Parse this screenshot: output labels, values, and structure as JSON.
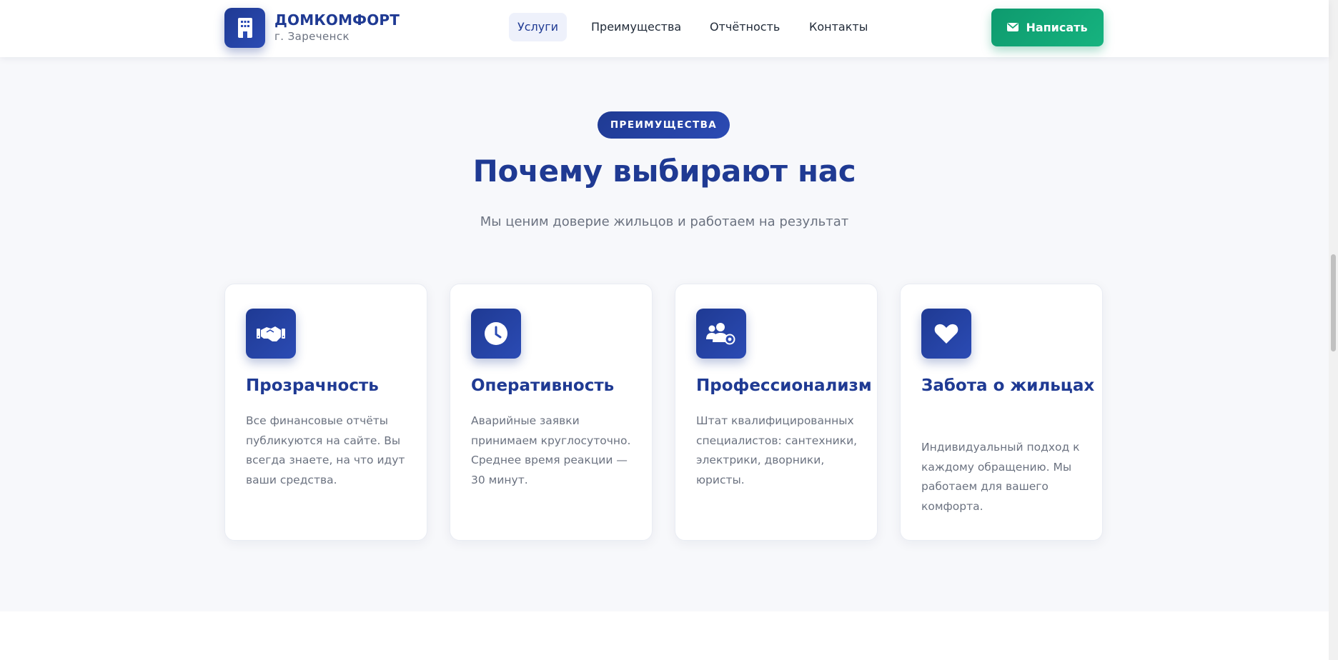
{
  "header": {
    "brand_name": "ДОМКОМФОРТ",
    "brand_city": "г. Зареченск",
    "nav": [
      {
        "label": "Услуги",
        "active": true
      },
      {
        "label": "Преимущества",
        "active": false
      },
      {
        "label": "Отчётность",
        "active": false
      },
      {
        "label": "Контакты",
        "active": false
      }
    ],
    "cta_label": "Написать"
  },
  "section": {
    "badge": "ПРЕИМУЩЕСТВА",
    "title": "Почему выбирают нас",
    "subtitle": "Мы ценим доверие жильцов и работаем на результат",
    "cards": [
      {
        "icon": "handshake-icon",
        "title": "Прозрачность",
        "text": "Все финансовые отчёты публикуются на сайте. Вы всегда знаете, на что идут ваши средства."
      },
      {
        "icon": "clock-icon",
        "title": "Оперативность",
        "text": "Аварийные заявки принимаем круглосуточно. Среднее время реакции — 30 минут."
      },
      {
        "icon": "users-gear-icon",
        "title": "Профессионализм",
        "text": "Штат квалифицированных специалистов: сантехники, электрики, дворники, юристы."
      },
      {
        "icon": "heart-icon",
        "title": "Забота о жильцах",
        "text": "Индивидуальный подход к каждому обращению. Мы работаем для вашего комфорта."
      }
    ]
  },
  "colors": {
    "primary": "#1f3a93",
    "accent": "#16b37f",
    "muted_text": "#6b7280",
    "background": "#f7f8fb"
  }
}
